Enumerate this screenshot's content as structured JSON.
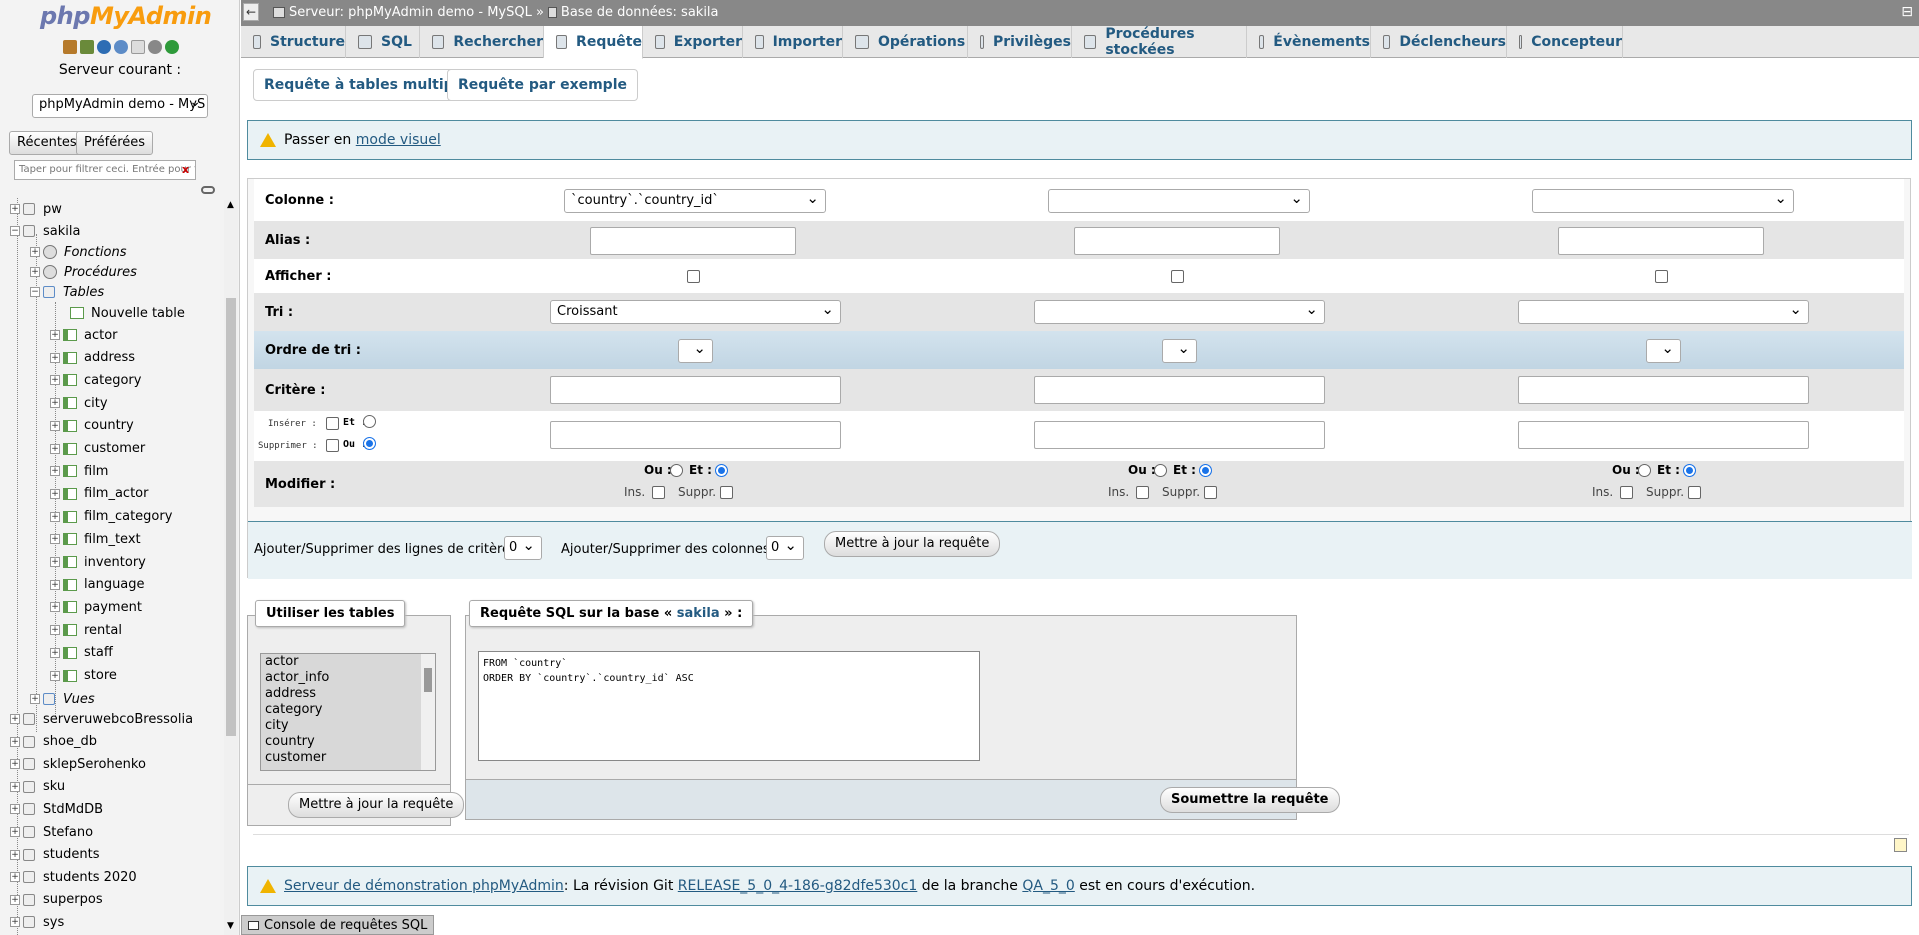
{
  "nav": {
    "logo_php": "php",
    "logo_admin": "MyAdmin",
    "server_label": "Serveur courant :",
    "server_select": "phpMyAdmin demo - MyS",
    "recent_btn": "Récentes",
    "prefs_btn": "Préférées",
    "filter_placeholder": "Taper pour filtrer ceci. Entrée pour tout",
    "tree": {
      "pw": "pw",
      "sakila": "sakila",
      "fonctions": "Fonctions",
      "procedures": "Procédures",
      "tables": "Tables",
      "nouvelle": "Nouvelle table",
      "t": [
        "actor",
        "address",
        "category",
        "city",
        "country",
        "customer",
        "film",
        "film_actor",
        "film_category",
        "film_text",
        "inventory",
        "language",
        "payment",
        "rental",
        "staff",
        "store"
      ],
      "vues": "Vues",
      "dbs": [
        "serveruwebcoBressolia",
        "shoe_db",
        "sklepSerohenko",
        "sku",
        "StdMdDB",
        "Stefano",
        "students",
        "students 2020",
        "superpos",
        "sys"
      ]
    }
  },
  "header": {
    "server_crumb": "Serveur: phpMyAdmin demo - MySQL »",
    "db_crumb": "Base de données: sakila"
  },
  "tabs": [
    "Structure",
    "SQL",
    "Rechercher",
    "Requête",
    "Exporter",
    "Importer",
    "Opérations",
    "Privilèges",
    "Procédures stockées",
    "Évènements",
    "Déclencheurs",
    "Concepteur"
  ],
  "subtabs": {
    "multi": "Requête à tables multiples",
    "example": "Requête par exemple"
  },
  "visual": {
    "prefix": "Passer en",
    "link": "mode visuel"
  },
  "grid": {
    "colonne": "Colonne :",
    "col1_value": "`country`.`country_id`",
    "alias": "Alias :",
    "afficher": "Afficher :",
    "tri": "Tri :",
    "tri1_value": "Croissant",
    "ordre": "Ordre de tri :",
    "critere": "Critère :",
    "inserer": "Insérer :",
    "supprimer": "Supprimer :",
    "et": "Et :",
    "ou": "Ou :",
    "modifier": "Modifier :",
    "ou_lbl": "Ou :",
    "et_lbl": "Et :",
    "ins": "Ins.",
    "suppr": "Suppr."
  },
  "rows_cols": {
    "lines_label": "Ajouter/Supprimer des lignes de critères:",
    "lines_value": "0",
    "cols_label": "Ajouter/Supprimer des colonnes:",
    "cols_value": "0",
    "update_btn": "Mettre à jour la requête"
  },
  "use_tables": {
    "legend": "Utiliser les tables",
    "items": [
      "actor",
      "actor_info",
      "address",
      "category",
      "city",
      "country",
      "customer"
    ],
    "update_btn": "Mettre à jour la requête"
  },
  "sql_query": {
    "legend_prefix": "Requête SQL sur la base «",
    "db": "sakila",
    "legend_suffix": "» :",
    "text": "FROM `country`\nORDER BY `country`.`country_id` ASC",
    "submit": "Soumettre la requête"
  },
  "footer": {
    "link1": "Serveur de démonstration phpMyAdmin",
    "t1": ": La révision Git",
    "link2": "RELEASE_5_0_4-186-g82dfe530c1",
    "t2": "de la branche",
    "link3": "QA_5_0",
    "t3": "est en cours d'exécution."
  },
  "console": "Console de requêtes SQL"
}
